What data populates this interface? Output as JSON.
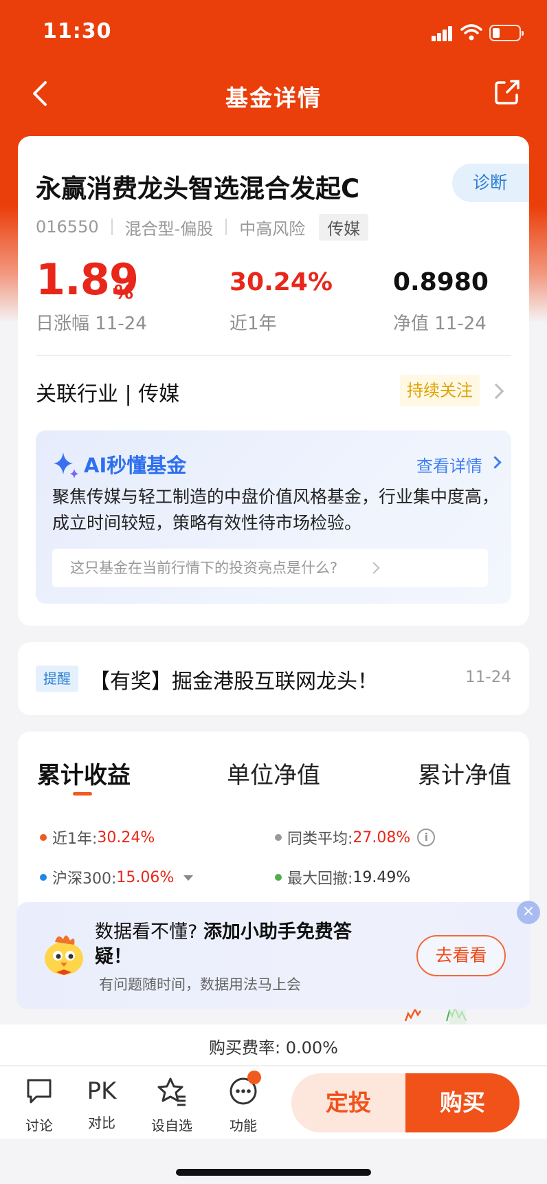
{
  "status_bar": {
    "time": "11:30"
  },
  "nav": {
    "title": "基金详情"
  },
  "fund": {
    "name": "永赢消费龙头智选混合发起C",
    "diagnose_label": "诊断",
    "code": "016550",
    "type": "混合型-偏股",
    "risk": "中高风险",
    "tag": "传媒",
    "daily_change": "1.89",
    "daily_change_unit": "%",
    "daily_change_label": "日涨幅 11-24",
    "year_return": "30.24%",
    "year_return_label": "近1年",
    "nav_value": "0.8980",
    "nav_label": "净值 11-24",
    "industry_label": "关联行业 | 传媒",
    "follow_label": "持续关注"
  },
  "ai": {
    "title": "AI秒懂基金",
    "detail_link": "查看详情",
    "description": "聚焦传媒与轻工制造的中盘价值风格基金，行业集中度高，成立时间较短，策略有效性待市场检验。",
    "question": "这只基金在当前行情下的投资亮点是什么?"
  },
  "notice": {
    "tag": "提醒",
    "text": "【有奖】掘金港股互联网龙头！",
    "date": "11-24"
  },
  "chart_section": {
    "tabs": [
      "累计收益",
      "单位净值",
      "累计净值"
    ],
    "stats": [
      {
        "label": "近1年:",
        "value": "30.24%",
        "color": "#f05a1e"
      },
      {
        "label": "同类平均:",
        "value": "27.08%",
        "color": "#999999"
      },
      {
        "label": "沪深300:",
        "value": "15.06%",
        "color": "#1e88e5"
      },
      {
        "label": "最大回撤:",
        "value": "19.49%",
        "color": "#4caf50"
      }
    ]
  },
  "promo": {
    "title_part1": "数据看不懂?",
    "title_part2": "添加小助手免费答疑！",
    "subtitle": "有问题随时间，数据用法马上会",
    "button": "去看看",
    "close": "×"
  },
  "fee": {
    "text": "购买费率: 0.00%"
  },
  "bottom_bar": {
    "items": [
      {
        "label": "讨论",
        "icon": "chat-bubble-icon"
      },
      {
        "label": "对比",
        "icon": "pk-icon",
        "glyph": "PK"
      },
      {
        "label": "设自选",
        "icon": "star-list-icon"
      },
      {
        "label": "功能",
        "icon": "more-icon"
      }
    ],
    "dingtou": "定投",
    "buy": "购买"
  },
  "colors": {
    "brand": "#ea3f0b",
    "up_red": "#e8271a",
    "ai_blue": "#2d6ff0",
    "buy_orange": "#f0521a"
  }
}
